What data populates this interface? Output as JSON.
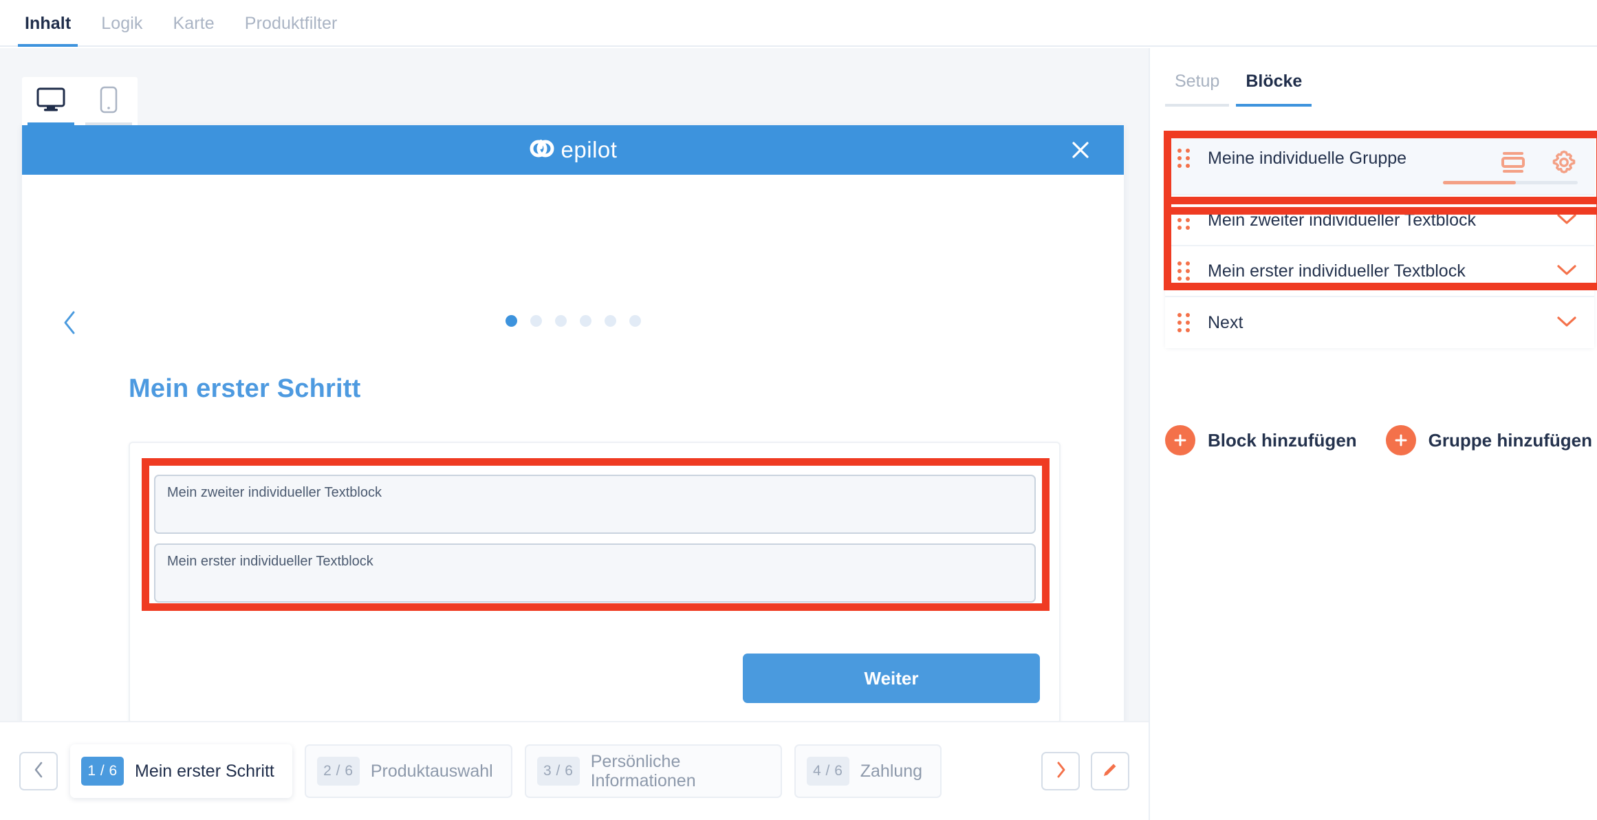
{
  "top_tabs": [
    {
      "label": "Inhalt",
      "active": true
    },
    {
      "label": "Logik",
      "active": false
    },
    {
      "label": "Karte",
      "active": false
    },
    {
      "label": "Produktfilter",
      "active": false
    }
  ],
  "device_toggle": {
    "desktop_icon": "desktop-monitor-icon",
    "mobile_icon": "mobile-phone-icon",
    "active": "desktop"
  },
  "preview": {
    "brand": "epilot",
    "close_icon": "close-x-icon",
    "back_icon": "chevron-left-icon",
    "step_dots": {
      "total": 6,
      "active_index": 0
    },
    "step_title": "Mein erster Schritt",
    "textblocks": [
      "Mein zweiter individueller Textblock",
      "Mein erster individueller Textblock"
    ],
    "submit_label": "Weiter"
  },
  "step_nav": {
    "prev_icon": "chevron-left-icon",
    "next_icon": "chevron-right-icon",
    "edit_icon": "pencil-edit-icon",
    "steps": [
      {
        "num": "1 / 6",
        "label": "Mein erster Schritt",
        "current": true
      },
      {
        "num": "2 / 6",
        "label": "Produktauswahl",
        "current": false
      },
      {
        "num": "3 / 6",
        "label": "Persönliche Informationen",
        "current": false
      },
      {
        "num": "4 / 6",
        "label": "Zahlung",
        "current": false
      }
    ]
  },
  "right_panel": {
    "tabs": [
      {
        "label": "Setup",
        "active": false
      },
      {
        "label": "Blöcke",
        "active": true
      }
    ],
    "group_row": {
      "label": "Meine individuelle Gruppe",
      "layout_icon": "layout-rows-icon",
      "settings_icon": "gear-icon"
    },
    "blocks": [
      {
        "label": "Mein zweiter individueller Textblock",
        "chevron": "chevron-down-icon"
      },
      {
        "label": "Mein erster individueller Textblock",
        "chevron": "chevron-down-icon"
      },
      {
        "label": "Next",
        "chevron": "chevron-down-icon"
      }
    ],
    "add_block_label": "Block hinzufügen",
    "add_group_label": "Gruppe hinzufügen",
    "add_icon": "plus-icon"
  },
  "colors": {
    "brand_blue": "#3d93dd",
    "accent_orange": "#f4714a",
    "annotation_red": "#ef3b22",
    "text_dark": "#1f2d4a",
    "bg_gray": "#f4f6f9"
  }
}
